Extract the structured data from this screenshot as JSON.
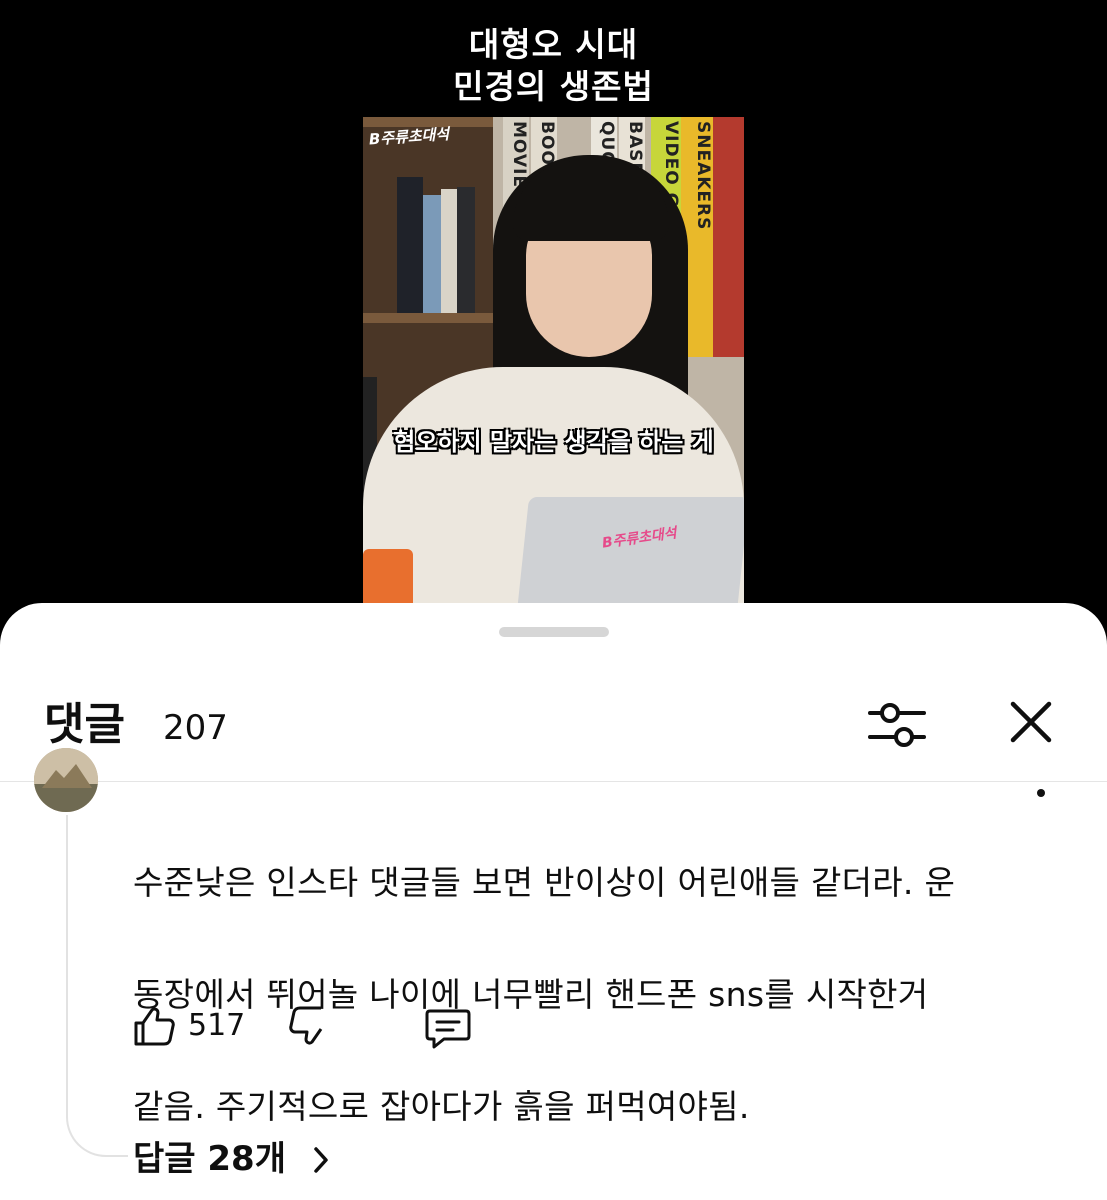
{
  "video": {
    "title_line1": "대형오 시대",
    "title_line2": "민경의 생존법",
    "subtitle": "혐오하지 말자는 생각을 하는 게",
    "channel_logo": "B주류초대석",
    "book_spines": [
      "MOVIE",
      "BOOK",
      "QUO",
      "BASEBALL",
      "VIDEO GAME",
      "SNEAKERS"
    ]
  },
  "comments_sheet": {
    "title": "댓글",
    "count": "207",
    "icons": {
      "filter": "sliders-icon",
      "close": "close-icon",
      "like": "thumbs-up-icon",
      "dislike": "thumbs-down-icon",
      "reply": "comment-icon",
      "chevron": "chevron-right-icon",
      "more": "more-vertical-icon"
    }
  },
  "comment": {
    "text_line1": "수준낮은 인스타 댓글들 보면 반이상이 어린애들 같더라. 운",
    "text_line2": "동장에서 뛰어놀 나이에 너무빨리 핸드폰 sns를 시작한거",
    "text_line3": "같음. 주기적으로 잡아다가 흙을 퍼먹여야됨.",
    "like_count": "517",
    "replies_label": "답글 28개"
  },
  "colors": {
    "background_top": "#000000",
    "sheet": "#ffffff",
    "text": "#0f0f0f",
    "thread_line": "#e2e2e2"
  }
}
